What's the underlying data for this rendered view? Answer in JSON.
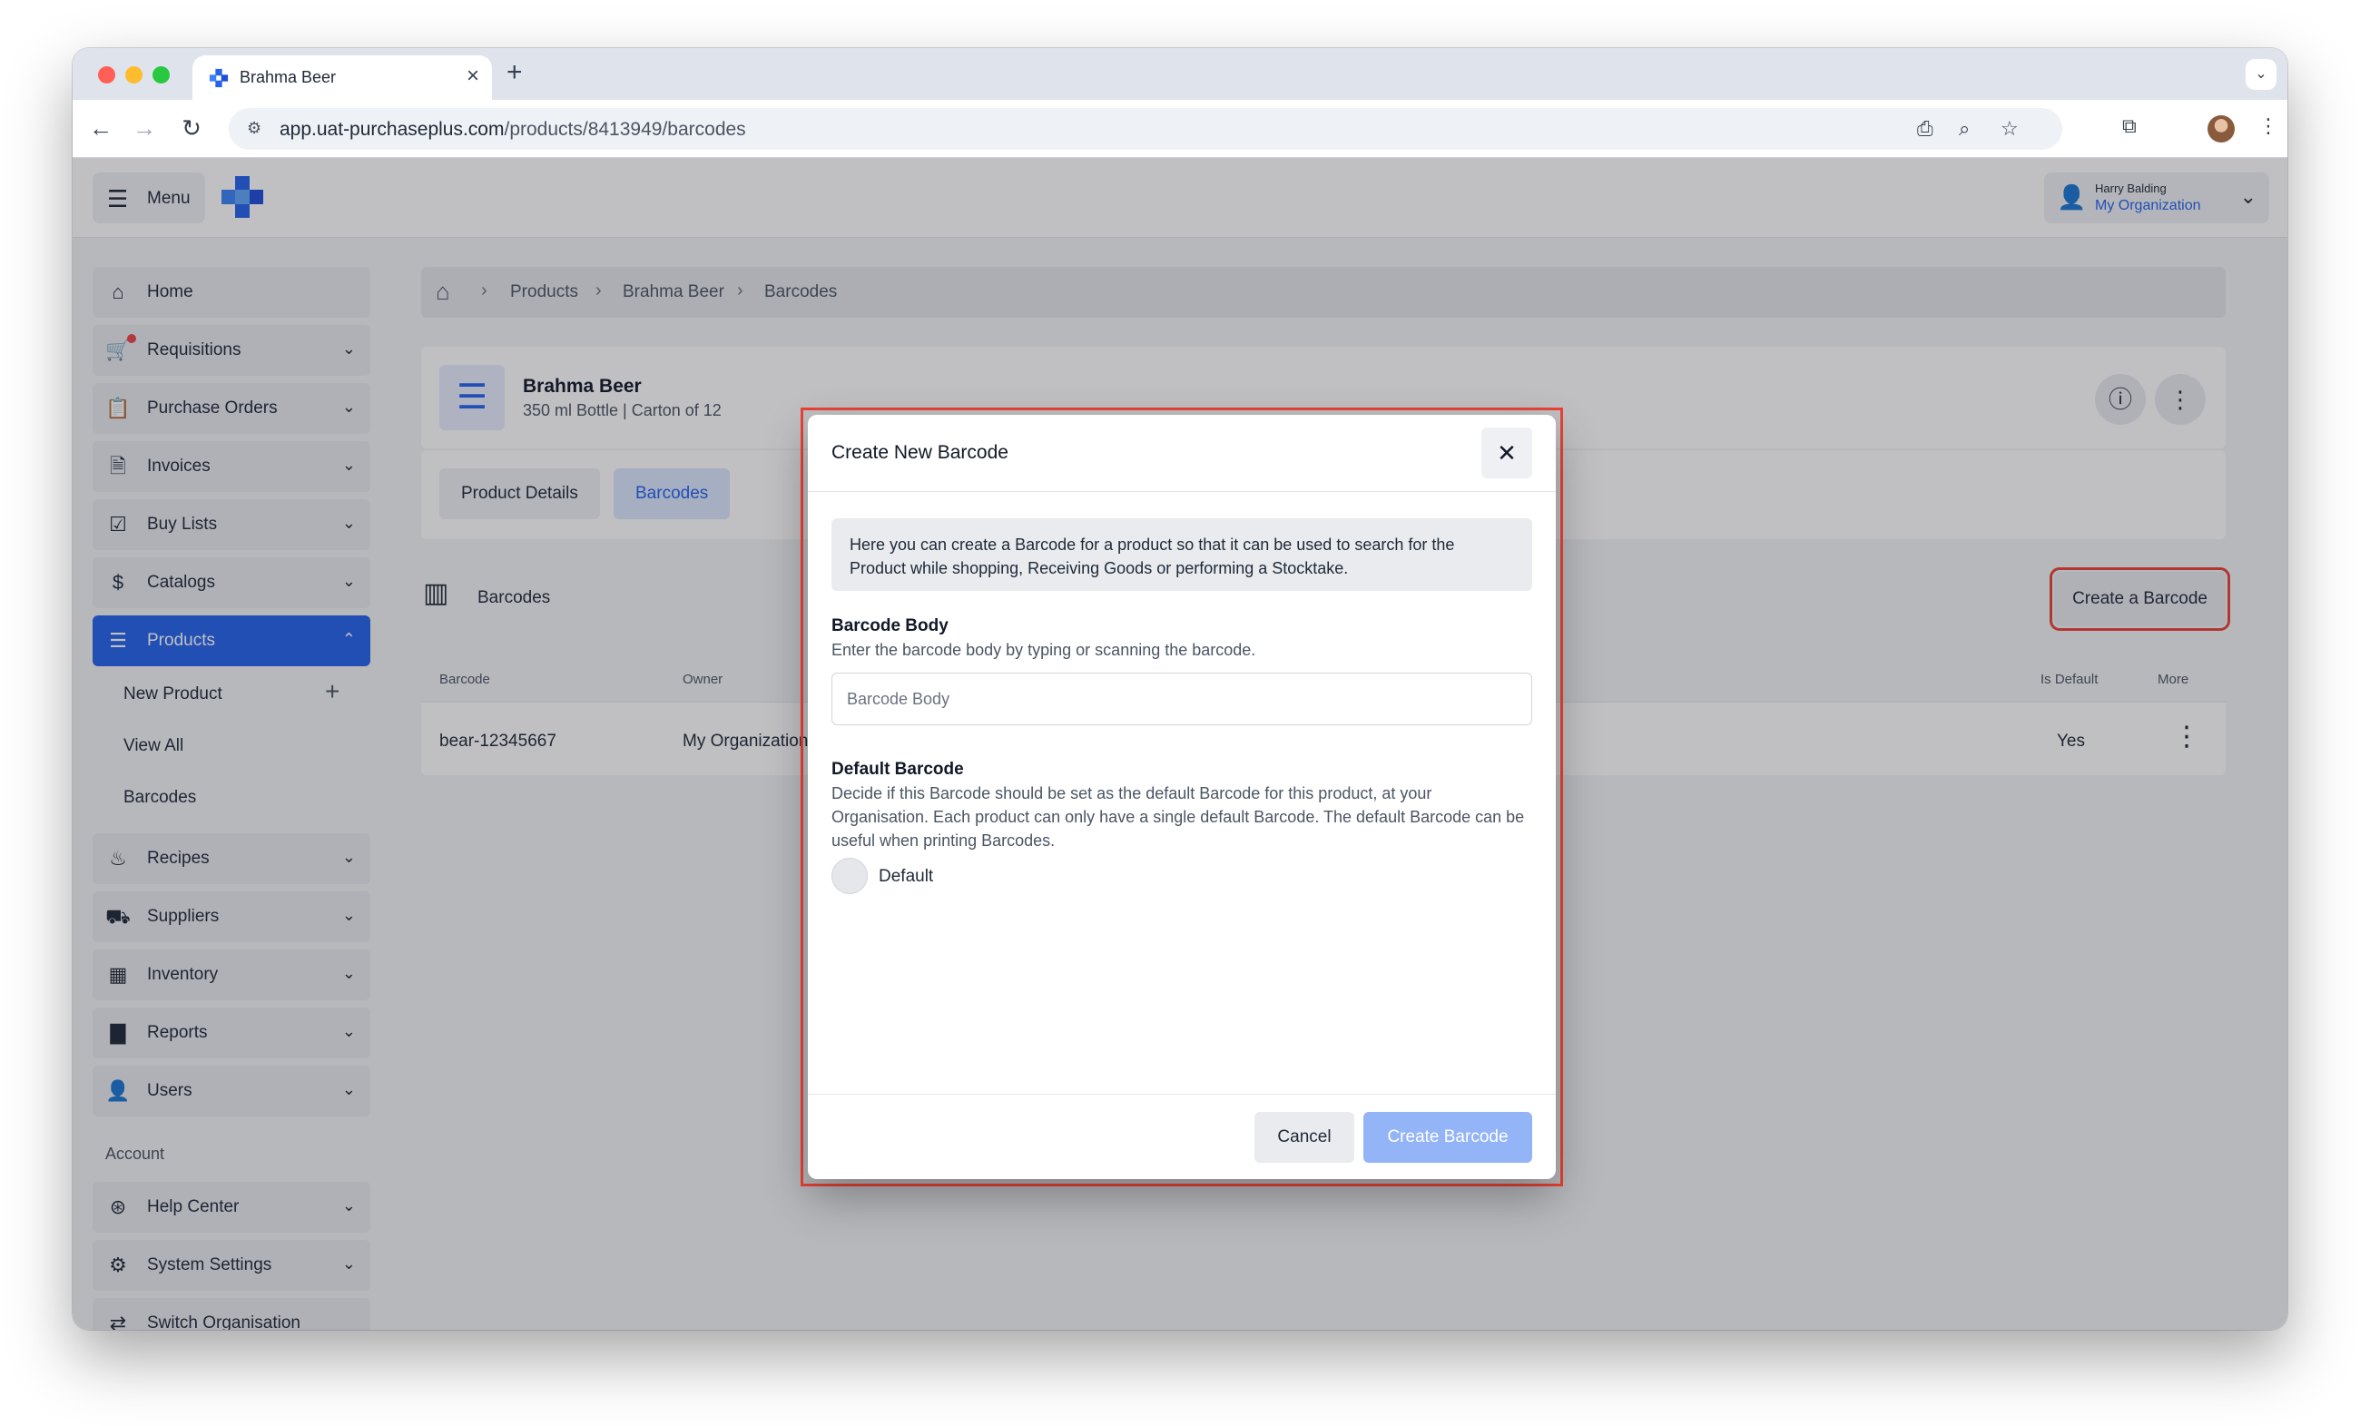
{
  "browser": {
    "tab_title": "Brahma Beer",
    "url_host": "app.uat-purchaseplus.com",
    "url_path": "/products/8413949/barcodes"
  },
  "header": {
    "menu_label": "Menu",
    "user_name": "Harry Balding",
    "user_org": "My Organization"
  },
  "sidebar": {
    "items": [
      {
        "label": "Home",
        "icon": "home-icon"
      },
      {
        "label": "Requisitions",
        "icon": "cart-icon"
      },
      {
        "label": "Purchase Orders",
        "icon": "clipboard-icon"
      },
      {
        "label": "Invoices",
        "icon": "document-icon"
      },
      {
        "label": "Buy Lists",
        "icon": "checklist-icon"
      },
      {
        "label": "Catalogs",
        "icon": "dollar-doc-icon"
      },
      {
        "label": "Products",
        "icon": "box-stack-icon"
      },
      {
        "label": "Recipes",
        "icon": "flame-icon"
      },
      {
        "label": "Suppliers",
        "icon": "truck-icon"
      },
      {
        "label": "Inventory",
        "icon": "boxes-icon"
      },
      {
        "label": "Reports",
        "icon": "bar-chart-icon"
      },
      {
        "label": "Users",
        "icon": "user-icon"
      }
    ],
    "products_sub": {
      "new_product": "New Product",
      "view_all": "View All",
      "barcodes": "Barcodes"
    },
    "account_label": "Account",
    "account_items": [
      {
        "label": "Help Center",
        "icon": "lifebuoy-icon"
      },
      {
        "label": "System Settings",
        "icon": "gear-icon"
      },
      {
        "label": "Switch Organisation",
        "icon": "switch-icon"
      }
    ]
  },
  "breadcrumb": [
    "Products",
    "Brahma Beer",
    "Barcodes"
  ],
  "product": {
    "name": "Brahma Beer",
    "subtitle": "350 ml Bottle | Carton of 12"
  },
  "tabs": {
    "product_details": "Product Details",
    "barcodes": "Barcodes"
  },
  "barcodes_section": {
    "title": "Barcodes",
    "create_button": "Create a Barcode"
  },
  "table": {
    "headers": {
      "barcode": "Barcode",
      "owner": "Owner",
      "is_default": "Is Default",
      "more": "More"
    },
    "rows": [
      {
        "barcode": "bear-12345667",
        "owner": "My Organization",
        "is_default": "Yes"
      }
    ]
  },
  "modal": {
    "title": "Create New Barcode",
    "info": "Here you can create a Barcode for a product so that it can be used to search for the Product while shopping, Receiving Goods or performing a Stocktake.",
    "body_label": "Barcode Body",
    "body_help": "Enter the barcode body by typing or scanning the barcode.",
    "body_placeholder": "Barcode Body",
    "default_label": "Default Barcode",
    "default_help": "Decide if this Barcode should be set as the default Barcode for this product, at your Organisation. Each product can only have a single default Barcode. The default Barcode can be useful when printing Barcodes.",
    "toggle_label": "Default",
    "cancel": "Cancel",
    "create": "Create Barcode"
  },
  "colors": {
    "accent": "#2563eb",
    "highlight_border": "#ea4335",
    "disabled_primary": "#93b4f7"
  }
}
